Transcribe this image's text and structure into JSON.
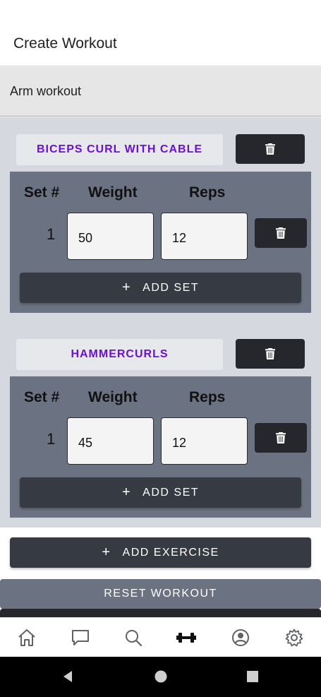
{
  "header": {
    "title": "Create Workout"
  },
  "workout": {
    "name": "Arm workout"
  },
  "table_headers": {
    "set": "Set #",
    "weight": "Weight",
    "reps": "Reps"
  },
  "exercises": [
    {
      "name": "BICEPS CURL WITH CABLE",
      "sets": [
        {
          "set": "1",
          "weight": "50",
          "reps": "12"
        }
      ],
      "add_set_label": "ADD SET"
    },
    {
      "name": "HAMMERCURLS",
      "sets": [
        {
          "set": "1",
          "weight": "45",
          "reps": "12"
        }
      ],
      "add_set_label": "ADD SET"
    }
  ],
  "actions": {
    "add_exercise_label": "ADD EXERCISE",
    "reset_label": "RESET WORKOUT"
  },
  "tabbar": {
    "items": [
      {
        "icon": "home-icon"
      },
      {
        "icon": "chat-icon"
      },
      {
        "icon": "search-icon"
      },
      {
        "icon": "dumbbell-icon",
        "active": true
      },
      {
        "icon": "account-icon"
      },
      {
        "icon": "settings-icon"
      }
    ]
  },
  "colors": {
    "accent": "#6a0fe0",
    "dark_button": "#25272c",
    "panel": "#6b7281",
    "content_bg": "#d5d8df"
  }
}
